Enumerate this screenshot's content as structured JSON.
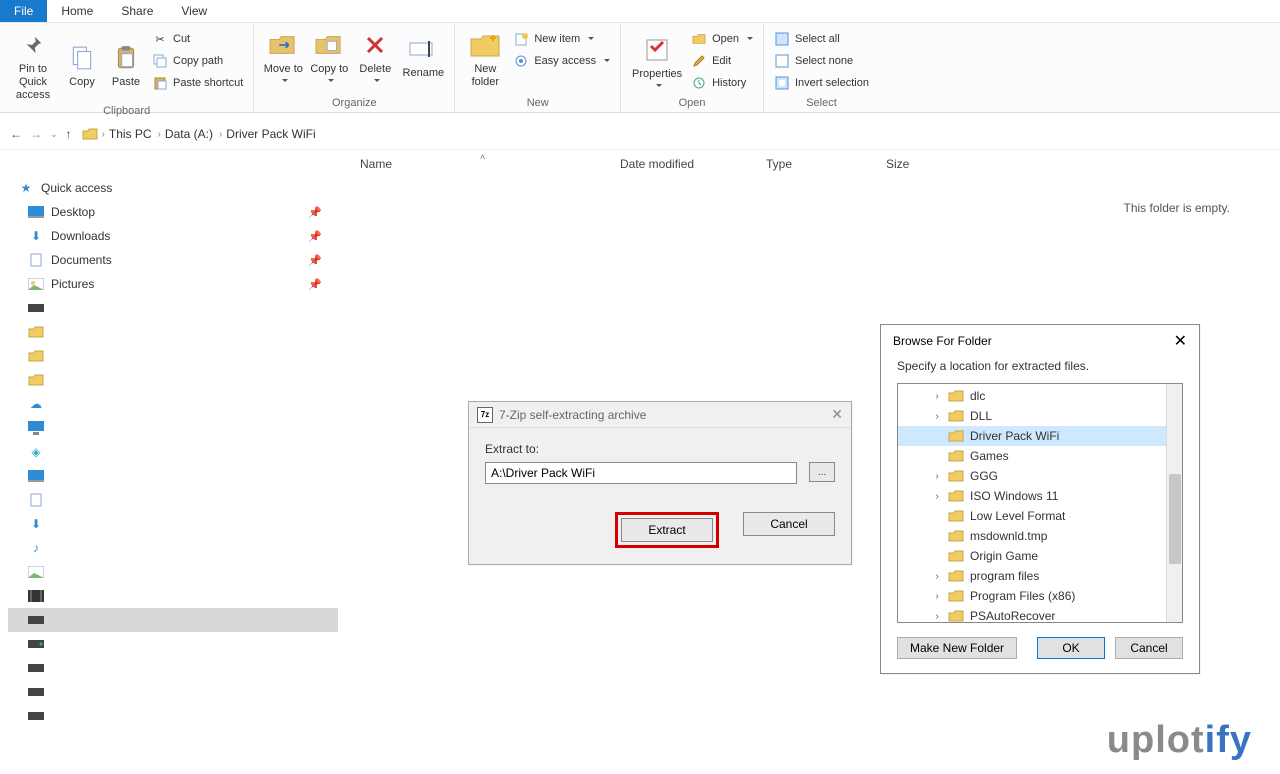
{
  "tabs": {
    "file": "File",
    "home": "Home",
    "share": "Share",
    "view": "View"
  },
  "ribbon": {
    "clipboard": {
      "label": "Clipboard",
      "pin": "Pin to Quick access",
      "copy": "Copy",
      "paste": "Paste",
      "cut": "Cut",
      "copy_path": "Copy path",
      "paste_shortcut": "Paste shortcut"
    },
    "organize": {
      "label": "Organize",
      "move_to": "Move to",
      "copy_to": "Copy to",
      "delete": "Delete",
      "rename": "Rename"
    },
    "new_group": {
      "label": "New",
      "new_folder": "New folder",
      "new_item": "New item",
      "easy_access": "Easy access"
    },
    "open_group": {
      "label": "Open",
      "properties": "Properties",
      "open": "Open",
      "edit": "Edit",
      "history": "History"
    },
    "select": {
      "label": "Select",
      "select_all": "Select all",
      "select_none": "Select none",
      "invert": "Invert selection"
    }
  },
  "breadcrumbs": [
    "This PC",
    "Data (A:)",
    "Driver Pack WiFi"
  ],
  "columns": {
    "name": "Name",
    "date": "Date modified",
    "type": "Type",
    "size": "Size"
  },
  "sidebar": {
    "quick_access": "Quick access",
    "items": [
      "Desktop",
      "Downloads",
      "Documents",
      "Pictures"
    ]
  },
  "empty_message": "This folder is empty.",
  "sevenzip": {
    "title": "7-Zip self-extracting archive",
    "extract_to_label": "Extract to:",
    "path": "A:\\Driver Pack WiFi",
    "browse_label": "...",
    "extract_btn": "Extract",
    "cancel_btn": "Cancel"
  },
  "browse_dialog": {
    "title": "Browse For Folder",
    "message": "Specify a location for extracted files.",
    "items": [
      {
        "name": "dlc",
        "expandable": true
      },
      {
        "name": "DLL",
        "expandable": true
      },
      {
        "name": "Driver Pack WiFi",
        "expandable": false,
        "selected": true
      },
      {
        "name": "Games",
        "expandable": false
      },
      {
        "name": "GGG",
        "expandable": true
      },
      {
        "name": "ISO Windows 11",
        "expandable": true
      },
      {
        "name": "Low Level Format",
        "expandable": false
      },
      {
        "name": "msdownld.tmp",
        "expandable": false
      },
      {
        "name": "Origin Game",
        "expandable": false
      },
      {
        "name": "program files",
        "expandable": true
      },
      {
        "name": "Program Files (x86)",
        "expandable": true
      },
      {
        "name": "PSAutoRecover",
        "expandable": true
      }
    ],
    "make_new": "Make New Folder",
    "ok": "OK",
    "cancel": "Cancel"
  },
  "watermark": {
    "a": "uplot",
    "b": "ify"
  }
}
